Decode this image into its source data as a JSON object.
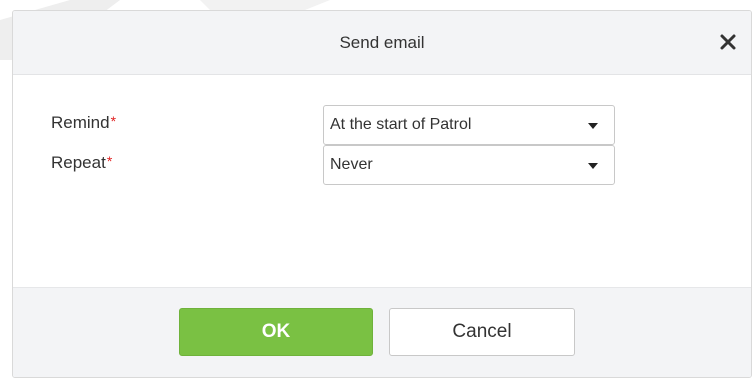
{
  "dialog": {
    "title": "Send email",
    "close_icon": "close-icon"
  },
  "form": {
    "remind": {
      "label": "Remind",
      "required_mark": "*",
      "value": "At the start of Patrol",
      "icon": "caret-down-icon"
    },
    "repeat": {
      "label": "Repeat",
      "required_mark": "*",
      "value": "Never",
      "icon": "caret-down-icon"
    }
  },
  "footer": {
    "ok_label": "OK",
    "cancel_label": "Cancel"
  },
  "colors": {
    "primary_button": "#7ac143",
    "required_mark": "#e02020",
    "header_background": "#f3f4f6"
  }
}
